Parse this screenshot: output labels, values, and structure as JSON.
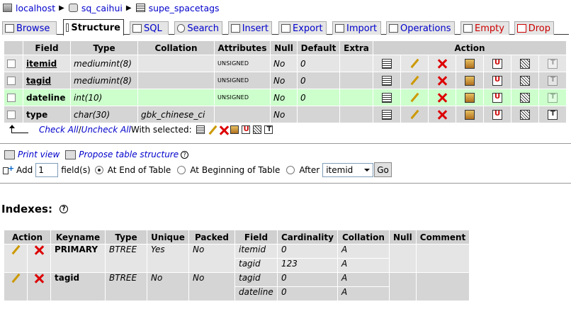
{
  "breadcrumb": {
    "server": "localhost",
    "database": "sq_caihui",
    "table": "supe_spacetags"
  },
  "tabs": [
    {
      "label": "Browse",
      "icon": "browse-icon"
    },
    {
      "label": "Structure",
      "icon": "structure-icon"
    },
    {
      "label": "SQL",
      "icon": "sql-icon"
    },
    {
      "label": "Search",
      "icon": "search-icon"
    },
    {
      "label": "Insert",
      "icon": "insert-icon"
    },
    {
      "label": "Export",
      "icon": "export-icon"
    },
    {
      "label": "Import",
      "icon": "import-icon"
    },
    {
      "label": "Operations",
      "icon": "operations-icon"
    },
    {
      "label": "Empty",
      "icon": "empty-icon"
    },
    {
      "label": "Drop",
      "icon": "drop-icon"
    }
  ],
  "structure": {
    "headers": [
      "Field",
      "Type",
      "Collation",
      "Attributes",
      "Null",
      "Default",
      "Extra",
      "Action"
    ],
    "rows": [
      {
        "field": "itemid",
        "type": "mediumint(8)",
        "collation": "",
        "attributes": "UNSIGNED",
        "null": "No",
        "default": "0",
        "extra": ""
      },
      {
        "field": "tagid",
        "type": "mediumint(8)",
        "collation": "",
        "attributes": "UNSIGNED",
        "null": "No",
        "default": "0",
        "extra": ""
      },
      {
        "field": "dateline",
        "type": "int(10)",
        "collation": "",
        "attributes": "UNSIGNED",
        "null": "No",
        "default": "0",
        "extra": ""
      },
      {
        "field": "type",
        "type": "char(30)",
        "collation": "gbk_chinese_ci",
        "attributes": "",
        "null": "No",
        "default": "",
        "extra": ""
      }
    ]
  },
  "with_selected": {
    "check_all": "Check All",
    "slash": " / ",
    "uncheck_all": "Uncheck All",
    "label": " With selected:"
  },
  "links": {
    "print_view": "Print view",
    "propose": "Propose table structure"
  },
  "add_fields": {
    "add_label": "Add",
    "count": "1",
    "fields_label": "field(s)",
    "at_end": "At End of Table",
    "at_beginning": "At Beginning of Table",
    "after": "After",
    "after_field": "itemid",
    "go": "Go"
  },
  "indexes": {
    "title": "Indexes:",
    "headers": [
      "Action",
      "Keyname",
      "Type",
      "Unique",
      "Packed",
      "Field",
      "Cardinality",
      "Collation",
      "Null",
      "Comment"
    ],
    "rows": [
      {
        "keyname": "PRIMARY",
        "type": "BTREE",
        "unique": "Yes",
        "packed": "No",
        "field": "itemid",
        "cardinality": "0",
        "collation": "A"
      },
      {
        "field": "tagid",
        "cardinality": "123",
        "collation": "A"
      },
      {
        "keyname": "tagid",
        "type": "BTREE",
        "unique": "No",
        "packed": "No",
        "field": "tagid",
        "cardinality": "0",
        "collation": "A"
      },
      {
        "field": "dateline",
        "cardinality": "0",
        "collation": "A"
      }
    ]
  }
}
